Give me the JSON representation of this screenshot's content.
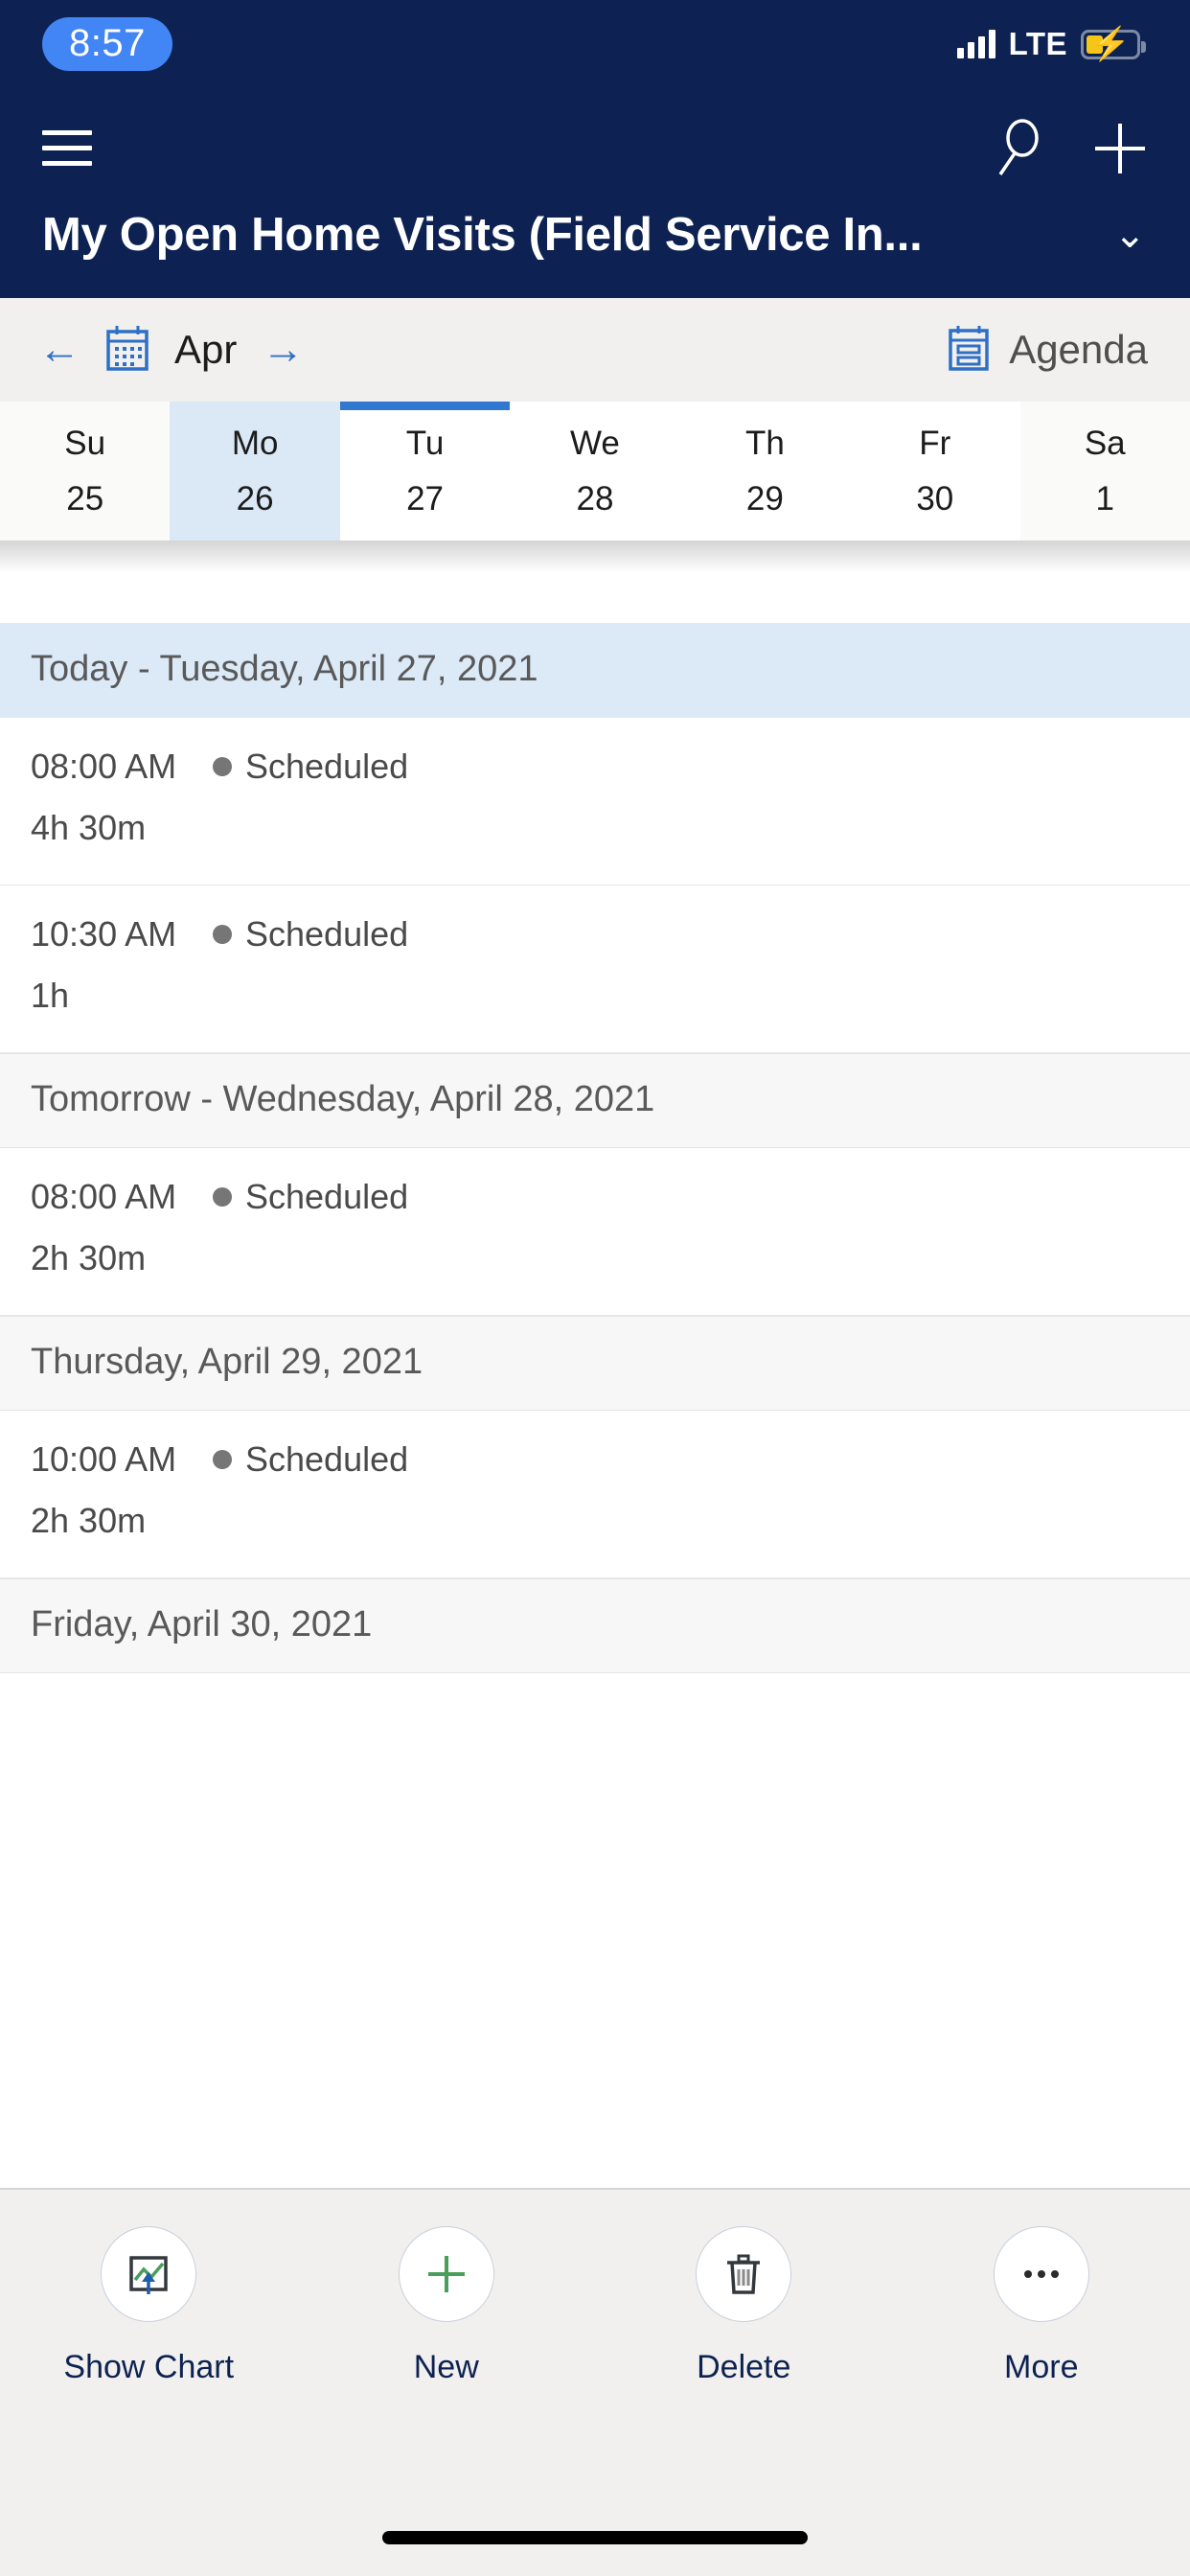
{
  "status_bar": {
    "time": "8:57",
    "network": "LTE",
    "signal_icon": "signal-bars-icon",
    "battery_icon": "battery-charging-icon",
    "accent": "#4285f4"
  },
  "app_bar": {
    "background": "#0d2252",
    "menu_icon": "hamburger-menu-icon",
    "search_icon": "search-icon",
    "new_icon": "plus-icon",
    "title": "My Open Home Visits (Field Service In...",
    "title_chevron": "chevron-down-icon"
  },
  "calendar_nav": {
    "prev_icon": "arrow-left-icon",
    "calendar_icon": "calendar-icon",
    "month": "Apr",
    "next_icon": "arrow-right-icon",
    "view_icon": "agenda-view-icon",
    "view_label": "Agenda",
    "accent": "#2f6fc4"
  },
  "week_strip": {
    "selected_index": 1,
    "today_index": 2,
    "today_bar_color": "#2f77cf",
    "selected_bg": "#dbe8f6",
    "days": [
      {
        "dow": "Su",
        "date": "25",
        "weekend": true
      },
      {
        "dow": "Mo",
        "date": "26",
        "weekend": false
      },
      {
        "dow": "Tu",
        "date": "27",
        "weekend": false
      },
      {
        "dow": "We",
        "date": "28",
        "weekend": false
      },
      {
        "dow": "Th",
        "date": "29",
        "weekend": false
      },
      {
        "dow": "Fr",
        "date": "30",
        "weekend": false
      },
      {
        "dow": "Sa",
        "date": "1",
        "weekend": true
      }
    ]
  },
  "agenda": {
    "status_dot_color": "#767676",
    "today_header_bg": "#dce9f7",
    "groups": [
      {
        "header": "Today - Tuesday, April 27, 2021",
        "is_today": true,
        "appointments": [
          {
            "time": "08:00 AM",
            "status": "Scheduled",
            "duration": "4h 30m"
          },
          {
            "time": "10:30 AM",
            "status": "Scheduled",
            "duration": "1h"
          }
        ]
      },
      {
        "header": "Tomorrow - Wednesday, April 28, 2021",
        "is_today": false,
        "appointments": [
          {
            "time": "08:00 AM",
            "status": "Scheduled",
            "duration": "2h 30m"
          }
        ]
      },
      {
        "header": "Thursday, April 29, 2021",
        "is_today": false,
        "appointments": [
          {
            "time": "10:00 AM",
            "status": "Scheduled",
            "duration": "2h 30m"
          }
        ]
      },
      {
        "header": "Friday, April 30, 2021",
        "is_today": false,
        "appointments": []
      }
    ]
  },
  "command_bar": {
    "items": [
      {
        "label": "Show Chart",
        "icon": "show-chart-icon"
      },
      {
        "label": "New",
        "icon": "plus-icon"
      },
      {
        "label": "Delete",
        "icon": "trash-icon"
      },
      {
        "label": "More",
        "icon": "ellipsis-icon"
      }
    ]
  }
}
